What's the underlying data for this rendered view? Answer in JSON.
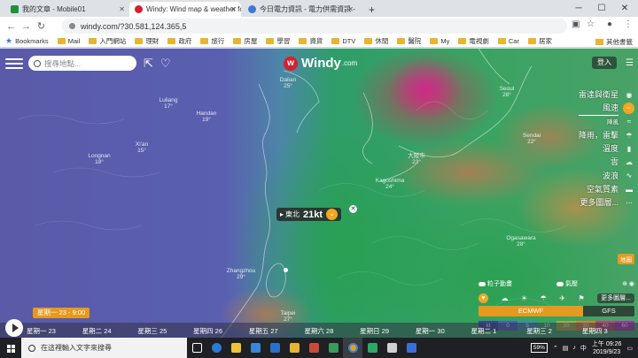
{
  "browser": {
    "tabs": [
      {
        "title": "我的文章 - Mobile01",
        "favicon_color": "#1f8f3a"
      },
      {
        "title": "Windy: Wind map & weather fo",
        "favicon_color": "#d61f2f"
      },
      {
        "title": "今日電力資訊 - 電力供需資訊 - 台",
        "favicon_color": "#3d78d8"
      }
    ],
    "new_tab": "+",
    "url": "windy.com/?30.581,124.365,5",
    "bookmarks_label": "Bookmarks",
    "bookmarks": [
      "Mail",
      "入門網站",
      "理財",
      "政府",
      "旅行",
      "房屋",
      "學習",
      "資貨",
      "DTV",
      "休閒",
      "醫院",
      "My",
      "電視劇",
      "Car",
      "居家"
    ],
    "other_bookmarks": "其他書籤"
  },
  "windy": {
    "search_placeholder": "搜尋地點...",
    "logo": "Windy",
    "logo_suffix": ".com",
    "login": "登入",
    "layers": [
      "雷達與衛星",
      "風速",
      "陣風",
      "降雨，雷擊",
      "溫度",
      "雲",
      "波浪",
      "空氣質素",
      "更多圖層..."
    ],
    "wind_popup": {
      "direction": "東北",
      "speed": "21kt"
    },
    "particles_label": "粒子動畫",
    "pressure_label": "氣壓",
    "more_layers": "更多圖層...",
    "models": {
      "selected": "ECMWF",
      "alt": "GFS"
    },
    "legend_unit": "kt",
    "legend_values": [
      "0",
      "5",
      "10",
      "20",
      "30",
      "40",
      "60"
    ],
    "minimap_label": "地圖",
    "current_time": "星期一 23 - 9:00",
    "days": [
      "星期一 23",
      "星期二 24",
      "星期三 25",
      "星期四 26",
      "星期五 27",
      "星期六 28",
      "星期日 29",
      "星期一 30",
      "星期二 1",
      "星期三 2",
      "星期四 3"
    ],
    "cities": [
      {
        "name": "Dalian",
        "temp": "25°"
      },
      {
        "name": "Seoul",
        "temp": "28°"
      },
      {
        "name": "Kagoshima",
        "temp": "24°"
      },
      {
        "name": "Ogasawara",
        "temp": "28°"
      },
      {
        "name": "Zhangzhou",
        "temp": "29°"
      },
      {
        "name": "Taipei",
        "temp": "27°"
      },
      {
        "name": "Luliang",
        "temp": "17°"
      },
      {
        "name": "Handan",
        "temp": "19°"
      },
      {
        "name": "Longnan",
        "temp": "18°"
      },
      {
        "name": "Xi'an",
        "temp": "15°"
      },
      {
        "name": "大阪市",
        "temp": "23°"
      },
      {
        "name": "Sendai",
        "temp": "22°"
      }
    ]
  },
  "taskbar": {
    "search_placeholder": "在這裡輸入文字來搜尋",
    "battery": "59%",
    "time": "上午 09:26",
    "date": "2019/9/23"
  }
}
